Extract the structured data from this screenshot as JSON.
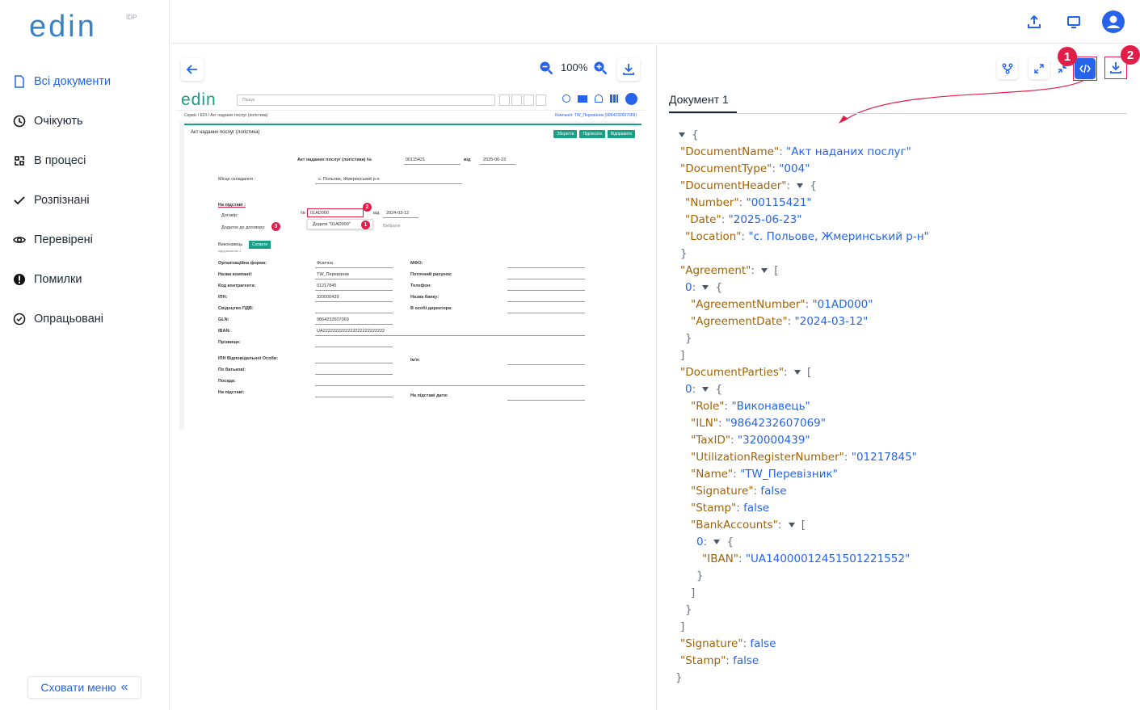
{
  "app": {
    "logo_text": "edin",
    "logo_sup": "IDP"
  },
  "sidebar": {
    "items": [
      {
        "label": "Всі документи",
        "icon": "document-icon",
        "active": true
      },
      {
        "label": "Очікують",
        "icon": "clock-icon"
      },
      {
        "label": "В процесі",
        "icon": "process-icon"
      },
      {
        "label": "Розпізнані",
        "icon": "check-icon"
      },
      {
        "label": "Перевірені",
        "icon": "eye-icon"
      },
      {
        "label": "Помилки",
        "icon": "error-icon"
      },
      {
        "label": "Опрацьовані",
        "icon": "check-circle-icon"
      }
    ],
    "hide_menu_label": "Сховати меню"
  },
  "viewer": {
    "zoom": "100%",
    "preview": {
      "search_placeholder": "Пошук",
      "breadcrumb": "Сервіс / EDI / Акт наданих послуг (логістика)",
      "company": "Компанія: TW_Перевізник (9864232607069)",
      "sheet_title": "Акт наданих послуг (логістика)",
      "buttons": [
        "Зберегти",
        "Підписати",
        "Відправити"
      ],
      "doc_heading": "Акт наданих послуг (логістика) №",
      "doc_number": "00115421",
      "date_label": "від",
      "doc_date": "2025-06-23",
      "place_label": "Місце складання :",
      "place_value": "с. Польове, Жмеринський р-н",
      "basis_label": "На підставі :",
      "contract_label": "Договір:",
      "contract_no_label": "№",
      "contract_no": "01AD000",
      "contract_date_label": "від",
      "contract_date": "2024-03-12",
      "addendum_label": "Додаток до договору:",
      "add_suggestion": "Додати \"01AD000\"",
      "choose": "Вибрати",
      "executor_label": "Виконавець",
      "executor_sub": "підприємство 1",
      "save_btn": "Сховати",
      "fields_left": [
        {
          "label": "Організаційна форма:",
          "value": "Фізична"
        },
        {
          "label": "Назва компанії:",
          "value": "TW_Перевізник"
        },
        {
          "label": "Код контрагента:",
          "value": "01217845"
        },
        {
          "label": "ІПН:",
          "value": "320000439"
        },
        {
          "label": "Свідоцтво ПДВ:",
          "value": ""
        },
        {
          "label": "GLN:",
          "value": "9864232607069"
        },
        {
          "label": "IBAN:",
          "value": "UA2222222222222222222222222"
        },
        {
          "label": "Прізвище:",
          "value": ""
        },
        {
          "label": "ІПН Відповідальної Особи:",
          "value": ""
        },
        {
          "label": "По батькові:",
          "value": ""
        },
        {
          "label": "Посада:",
          "value": ""
        },
        {
          "label": "На підставі:",
          "value": ""
        }
      ],
      "fields_right": [
        {
          "label": "МФО:"
        },
        {
          "label": "Поточний рахунок:"
        },
        {
          "label": "Телефон:"
        },
        {
          "label": "Назва банку:"
        },
        {
          "label": "В особі директора:"
        },
        {
          "label": "Ім'я:"
        },
        {
          "label": "На підставі дати:"
        }
      ],
      "markers": [
        "1",
        "2",
        "3"
      ]
    }
  },
  "json_panel": {
    "tab": "Документ 1",
    "badges": [
      "1",
      "2"
    ]
  }
}
